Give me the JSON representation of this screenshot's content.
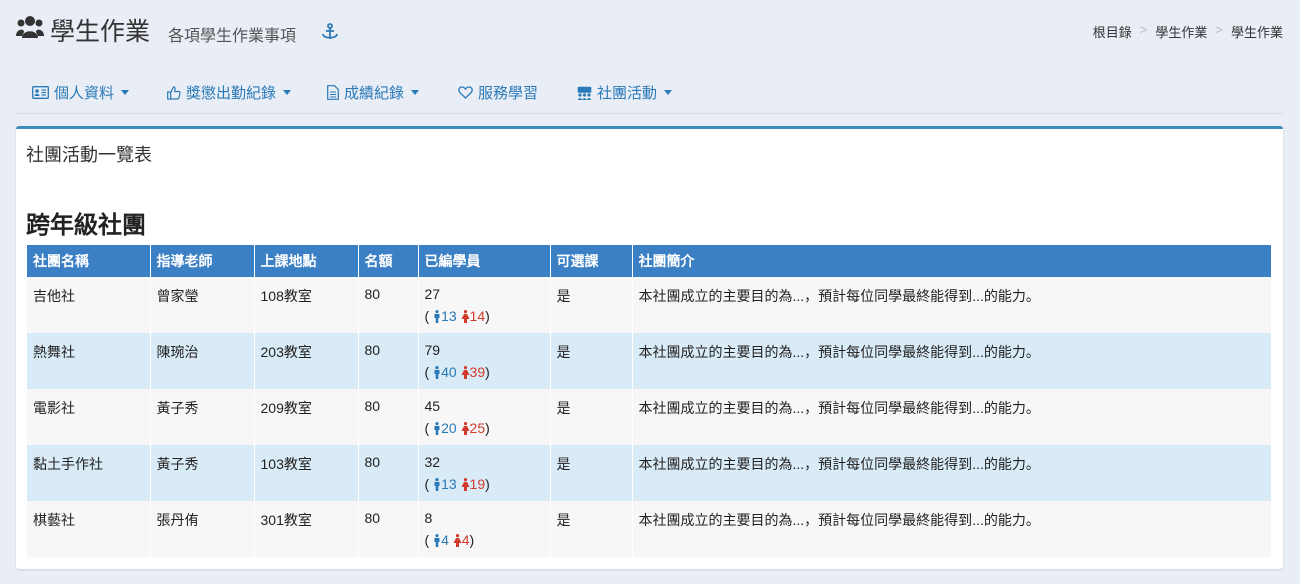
{
  "header": {
    "title": "學生作業",
    "subtitle": "各項學生作業事項"
  },
  "breadcrumb": [
    "根目錄",
    "學生作業",
    "學生作業"
  ],
  "nav": [
    {
      "label": "個人資料",
      "icon": "id-card-icon",
      "dropdown": true
    },
    {
      "label": "獎懲出勤紀錄",
      "icon": "thumbs-up-icon",
      "dropdown": true
    },
    {
      "label": "成績紀錄",
      "icon": "document-icon",
      "dropdown": true
    },
    {
      "label": "服務學習",
      "icon": "heart-icon",
      "dropdown": false
    },
    {
      "label": "社團活動",
      "icon": "group-icon",
      "dropdown": true
    }
  ],
  "panel": {
    "title": "社團活動一覽表",
    "section_title": "跨年級社團"
  },
  "table": {
    "headers": [
      "社團名稱",
      "指導老師",
      "上課地點",
      "名額",
      "已編學員",
      "可選課",
      "社團簡介"
    ],
    "rows": [
      {
        "name": "吉他社",
        "teacher": "曾家瑩",
        "location": "108教室",
        "quota": "80",
        "enrolled": "27",
        "male": "13",
        "female": "14",
        "selectable": "是",
        "intro": "本社團成立的主要目的為...，預計每位同學最終能得到...的能力。"
      },
      {
        "name": "熱舞社",
        "teacher": "陳琬治",
        "location": "203教室",
        "quota": "80",
        "enrolled": "79",
        "male": "40",
        "female": "39",
        "selectable": "是",
        "intro": "本社團成立的主要目的為...，預計每位同學最終能得到...的能力。"
      },
      {
        "name": "電影社",
        "teacher": "黃子秀",
        "location": "209教室",
        "quota": "80",
        "enrolled": "45",
        "male": "20",
        "female": "25",
        "selectable": "是",
        "intro": "本社團成立的主要目的為...，預計每位同學最終能得到...的能力。"
      },
      {
        "name": "黏土手作社",
        "teacher": "黃子秀",
        "location": "103教室",
        "quota": "80",
        "enrolled": "32",
        "male": "13",
        "female": "19",
        "selectable": "是",
        "intro": "本社團成立的主要目的為...，預計每位同學最終能得到...的能力。"
      },
      {
        "name": "棋藝社",
        "teacher": "張丹侑",
        "location": "301教室",
        "quota": "80",
        "enrolled": "8",
        "male": "4",
        "female": "4",
        "selectable": "是",
        "intro": "本社團成立的主要目的為...，預計每位同學最終能得到...的能力。"
      }
    ]
  },
  "colors": {
    "accent": "#3c8dbc",
    "table_header": "#3b7fc4",
    "link": "#2a7ab8",
    "male": "#2a7ab8",
    "female": "#d33a2c",
    "row_alt": "#d9ebf7"
  }
}
